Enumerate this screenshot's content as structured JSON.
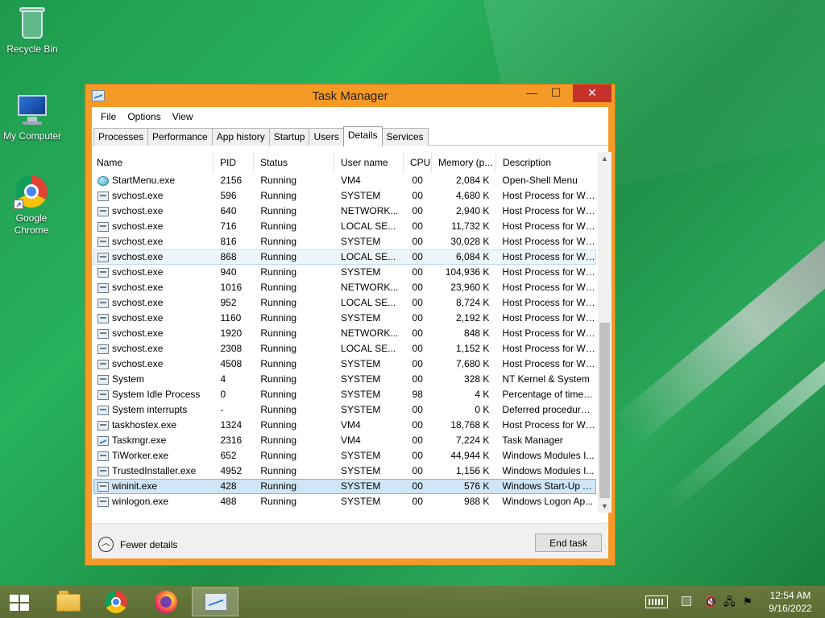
{
  "desktop": {
    "icons": [
      {
        "label": "Recycle Bin"
      },
      {
        "label": "My Computer"
      },
      {
        "label": "Google Chrome"
      }
    ]
  },
  "window": {
    "title": "Task Manager",
    "controls": {
      "minimize": "—",
      "maximize": "☐",
      "close": "✕"
    },
    "menu": [
      "File",
      "Options",
      "View"
    ],
    "tabs": [
      "Processes",
      "Performance",
      "App history",
      "Startup",
      "Users",
      "Details",
      "Services"
    ],
    "active_tab": "Details",
    "columns": {
      "name": "Name",
      "pid": "PID",
      "status": "Status",
      "user": "User name",
      "cpu": "CPU",
      "memory": "Memory (p...",
      "description": "Description"
    },
    "rows": [
      {
        "name": "StartMenu.exe",
        "pid": "2156",
        "status": "Running",
        "user": "VM4",
        "cpu": "00",
        "memory": "2,084 K",
        "description": "Open-Shell Menu",
        "icon": "startmenu-icon"
      },
      {
        "name": "svchost.exe",
        "pid": "596",
        "status": "Running",
        "user": "SYSTEM",
        "cpu": "00",
        "memory": "4,680 K",
        "description": "Host Process for Wi...",
        "icon": "process-icon"
      },
      {
        "name": "svchost.exe",
        "pid": "640",
        "status": "Running",
        "user": "NETWORK...",
        "cpu": "00",
        "memory": "2,940 K",
        "description": "Host Process for Wi...",
        "icon": "process-icon"
      },
      {
        "name": "svchost.exe",
        "pid": "716",
        "status": "Running",
        "user": "LOCAL SE...",
        "cpu": "00",
        "memory": "11,732 K",
        "description": "Host Process for Wi...",
        "icon": "process-icon"
      },
      {
        "name": "svchost.exe",
        "pid": "816",
        "status": "Running",
        "user": "SYSTEM",
        "cpu": "00",
        "memory": "30,028 K",
        "description": "Host Process for Wi...",
        "icon": "process-icon"
      },
      {
        "name": "svchost.exe",
        "pid": "868",
        "status": "Running",
        "user": "LOCAL SE...",
        "cpu": "00",
        "memory": "6,084 K",
        "description": "Host Process for Wi...",
        "icon": "process-icon"
      },
      {
        "name": "svchost.exe",
        "pid": "940",
        "status": "Running",
        "user": "SYSTEM",
        "cpu": "00",
        "memory": "104,936 K",
        "description": "Host Process for Wi...",
        "icon": "process-icon"
      },
      {
        "name": "svchost.exe",
        "pid": "1016",
        "status": "Running",
        "user": "NETWORK...",
        "cpu": "00",
        "memory": "23,960 K",
        "description": "Host Process for Wi...",
        "icon": "process-icon"
      },
      {
        "name": "svchost.exe",
        "pid": "952",
        "status": "Running",
        "user": "LOCAL SE...",
        "cpu": "00",
        "memory": "8,724 K",
        "description": "Host Process for Wi...",
        "icon": "process-icon"
      },
      {
        "name": "svchost.exe",
        "pid": "1160",
        "status": "Running",
        "user": "SYSTEM",
        "cpu": "00",
        "memory": "2,192 K",
        "description": "Host Process for Wi...",
        "icon": "process-icon"
      },
      {
        "name": "svchost.exe",
        "pid": "1920",
        "status": "Running",
        "user": "NETWORK...",
        "cpu": "00",
        "memory": "848 K",
        "description": "Host Process for Wi...",
        "icon": "process-icon"
      },
      {
        "name": "svchost.exe",
        "pid": "2308",
        "status": "Running",
        "user": "LOCAL SE...",
        "cpu": "00",
        "memory": "1,152 K",
        "description": "Host Process for Wi...",
        "icon": "process-icon"
      },
      {
        "name": "svchost.exe",
        "pid": "4508",
        "status": "Running",
        "user": "SYSTEM",
        "cpu": "00",
        "memory": "7,680 K",
        "description": "Host Process for Wi...",
        "icon": "process-icon"
      },
      {
        "name": "System",
        "pid": "4",
        "status": "Running",
        "user": "SYSTEM",
        "cpu": "00",
        "memory": "328 K",
        "description": "NT Kernel & System",
        "icon": "process-icon"
      },
      {
        "name": "System Idle Process",
        "pid": "0",
        "status": "Running",
        "user": "SYSTEM",
        "cpu": "98",
        "memory": "4 K",
        "description": "Percentage of time t...",
        "icon": "process-icon"
      },
      {
        "name": "System interrupts",
        "pid": "-",
        "status": "Running",
        "user": "SYSTEM",
        "cpu": "00",
        "memory": "0 K",
        "description": "Deferred procedure ...",
        "icon": "process-icon"
      },
      {
        "name": "taskhostex.exe",
        "pid": "1324",
        "status": "Running",
        "user": "VM4",
        "cpu": "00",
        "memory": "18,768 K",
        "description": "Host Process for Wi...",
        "icon": "process-icon"
      },
      {
        "name": "Taskmgr.exe",
        "pid": "2316",
        "status": "Running",
        "user": "VM4",
        "cpu": "00",
        "memory": "7,224 K",
        "description": "Task Manager",
        "icon": "taskmgr-icon"
      },
      {
        "name": "TiWorker.exe",
        "pid": "652",
        "status": "Running",
        "user": "SYSTEM",
        "cpu": "00",
        "memory": "44,944 K",
        "description": "Windows Modules I...",
        "icon": "process-icon"
      },
      {
        "name": "TrustedInstaller.exe",
        "pid": "4952",
        "status": "Running",
        "user": "SYSTEM",
        "cpu": "00",
        "memory": "1,156 K",
        "description": "Windows Modules I...",
        "icon": "process-icon"
      },
      {
        "name": "wininit.exe",
        "pid": "428",
        "status": "Running",
        "user": "SYSTEM",
        "cpu": "00",
        "memory": "576 K",
        "description": "Windows Start-Up A...",
        "icon": "process-icon"
      },
      {
        "name": "winlogon.exe",
        "pid": "488",
        "status": "Running",
        "user": "SYSTEM",
        "cpu": "00",
        "memory": "988 K",
        "description": "Windows Logon Ap...",
        "icon": "process-icon"
      }
    ],
    "hover_row_index": 5,
    "selected_row_index": 20,
    "footer": {
      "fewer_details": "Fewer details",
      "end_task": "End task"
    }
  },
  "taskbar": {
    "items": [
      "start-icon",
      "file-explorer-icon",
      "chrome-icon",
      "firefox-icon",
      "task-manager-icon"
    ],
    "clock": {
      "time": "12:54 AM",
      "date": "9/16/2022"
    }
  },
  "colors": {
    "window_frame": "#f59a27",
    "close_button": "#c7312b",
    "selection": "#cfe6f7",
    "hover": "#eef6fb"
  }
}
